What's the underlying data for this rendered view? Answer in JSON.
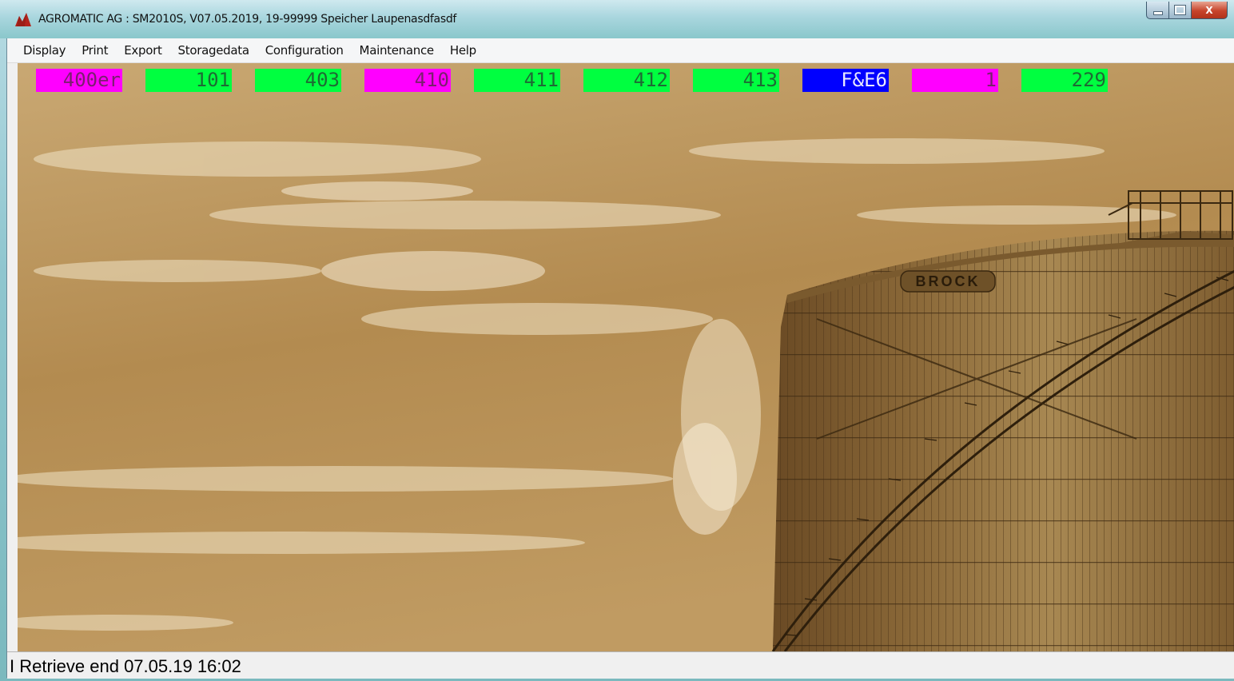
{
  "window": {
    "title": "AGROMATIC AG : SM2010S, V07.05.2019, 19-99999 Speicher Laupenasdfasdf",
    "controls": {
      "minimize_icon": "minimize-icon",
      "maximize_icon": "maximize-icon",
      "close_label": "X"
    }
  },
  "menu": {
    "items": [
      {
        "label": "Display"
      },
      {
        "label": "Print"
      },
      {
        "label": "Export"
      },
      {
        "label": "Storagedata"
      },
      {
        "label": "Configuration"
      },
      {
        "label": "Maintenance"
      },
      {
        "label": "Help"
      }
    ]
  },
  "status_boxes": [
    {
      "label": "400er",
      "bg": "#ff00ff",
      "fg": "#7a1f6e"
    },
    {
      "label": "101",
      "bg": "#00ff40",
      "fg": "#1e6a34"
    },
    {
      "label": "403",
      "bg": "#00ff40",
      "fg": "#1e6a34"
    },
    {
      "label": "410",
      "bg": "#ff00ff",
      "fg": "#7a1f6e"
    },
    {
      "label": "411",
      "bg": "#00ff40",
      "fg": "#1e6a34"
    },
    {
      "label": "412",
      "bg": "#00ff40",
      "fg": "#1e6a34"
    },
    {
      "label": "413",
      "bg": "#00ff40",
      "fg": "#1e6a34"
    },
    {
      "label": "F&E6",
      "bg": "#0000ff",
      "fg": "#e8e8ff"
    },
    {
      "label": "1",
      "bg": "#ff00ff",
      "fg": "#7a1f6e"
    },
    {
      "label": "229",
      "bg": "#00ff40",
      "fg": "#1e6a34"
    }
  ],
  "scene": {
    "silo_text": "BROCK",
    "background_image": "sepia-grain-silo-photo"
  },
  "statusbar": {
    "text": "I Retrieve end  07.05.19 16:02"
  }
}
